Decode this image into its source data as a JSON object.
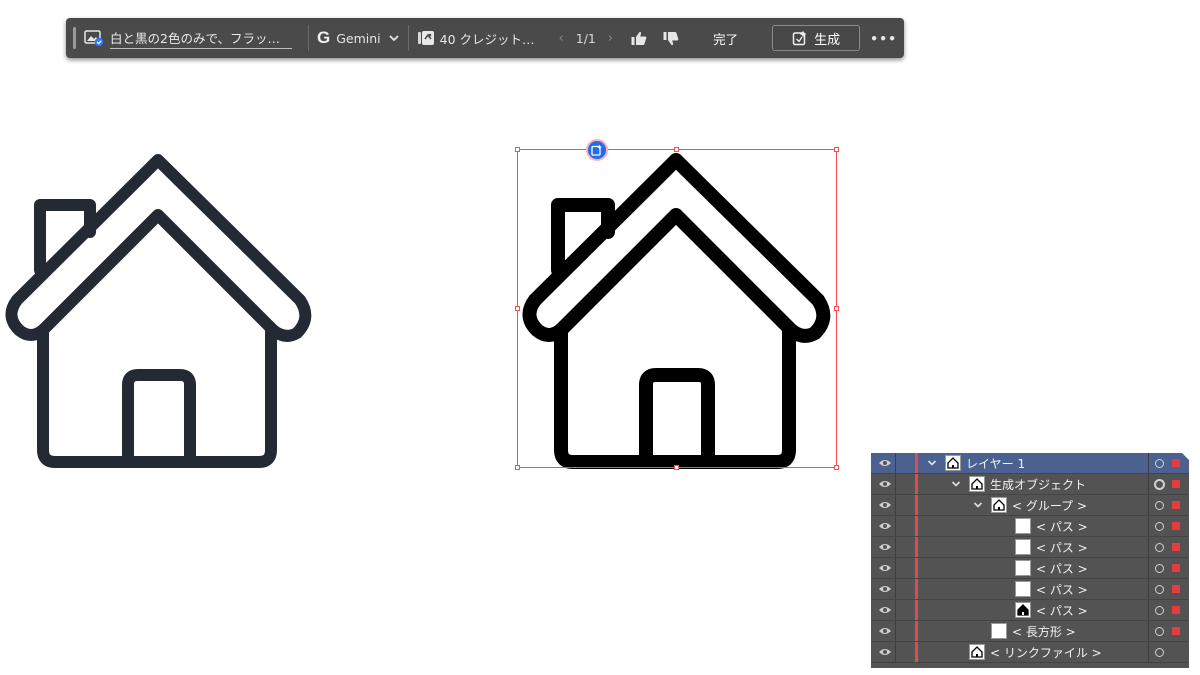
{
  "taskbar": {
    "prompt": "白と黒の2色のみで、フラッ…",
    "model_letter": "G",
    "model": "Gemini",
    "credits": "40 クレジット…",
    "pager_prev": "‹",
    "pager_count": "1/1",
    "pager_next": "›",
    "done": "完了",
    "generate": "生成",
    "more": "•••"
  },
  "colors": {
    "left_house_stroke": "#242a33",
    "right_house_stroke": "#000000",
    "selection": "#ff4c4c",
    "badge": "#1f6ef0",
    "panel_bg": "#535353",
    "panel_selected": "#4b6290",
    "layer_color": "#e14b4b"
  },
  "layers": {
    "rows": [
      {
        "name": "レイヤー 1",
        "thumb": "layer"
      },
      {
        "name": "生成オブジェクト",
        "thumb": "house"
      },
      {
        "name": "< グループ >",
        "thumb": "house"
      },
      {
        "name": "< パス >",
        "thumb": "white"
      },
      {
        "name": "< パス >",
        "thumb": "white"
      },
      {
        "name": "< パス >",
        "thumb": "white"
      },
      {
        "name": "< パス >",
        "thumb": "white"
      },
      {
        "name": "< パス >",
        "thumb": "black-house"
      },
      {
        "name": "< 長方形 >",
        "thumb": "white"
      },
      {
        "name": "< リンクファイル >",
        "thumb": "house"
      }
    ]
  }
}
